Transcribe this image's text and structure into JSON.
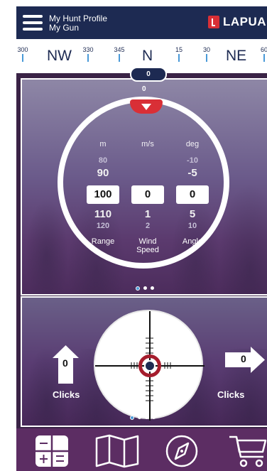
{
  "header": {
    "profile_name": "My Hunt Profile",
    "gun_name": "My Gun",
    "brand": "LAPUA"
  },
  "compass": {
    "ticks": [
      "300",
      "330",
      "345",
      "15",
      "30",
      "60"
    ],
    "directions": [
      "NW",
      "N",
      "NE"
    ],
    "heading": "0"
  },
  "dial": {
    "top_value": "0",
    "units": [
      "m",
      "m/s",
      "deg"
    ],
    "range": {
      "above2": "80",
      "above1": "90",
      "current": "100",
      "below1": "110",
      "below2": "120",
      "label": "Range"
    },
    "wind": {
      "current": "0",
      "below1": "1",
      "below2": "2",
      "label_line1": "Wind",
      "label_line2": "Speed"
    },
    "angle": {
      "above2": "-10",
      "above1": "-5",
      "current": "0",
      "below1": "5",
      "below2": "10",
      "label": "Angle"
    }
  },
  "scope": {
    "vertical_clicks": "0",
    "horizontal_clicks": "0",
    "clicks_label_left": "Clicks",
    "clicks_label_right": "Clicks"
  },
  "colors": {
    "navy": "#1d2a52",
    "accent_red": "#d92f36",
    "reticle_red": "#a51d2d",
    "nav_bg": "#5c2d63",
    "dot_active": "#4a9ad8"
  },
  "nav": {
    "icons": [
      "calculator-icon",
      "map-icon",
      "compass-icon",
      "cart-icon"
    ]
  }
}
